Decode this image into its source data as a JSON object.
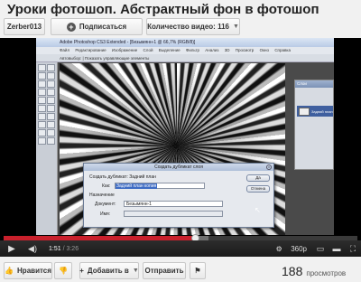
{
  "video_title": "Уроки фотошоп. Абстрактный фон в фотошоп",
  "channel": {
    "name": "Zerber013",
    "subscribe_label": "Подписаться",
    "video_count_label": "Количество видео: 116"
  },
  "photoshop": {
    "window_title": "Adobe Photoshop CS3 Extended - [Безымянн-1 @ 66,7% (RGB/8)]",
    "menu": [
      "Файл",
      "Редактирование",
      "Изображение",
      "Слой",
      "Выделение",
      "Фильтр",
      "Анализ",
      "3D",
      "Просмотр",
      "Окно",
      "Справка"
    ],
    "options_bar": "Автовыбор: | Показать управляющие элементы",
    "layers_panel": {
      "header": "Слои",
      "layer_name": "Задний план"
    },
    "dialog": {
      "title": "Создать дубликат слоя",
      "duplicate_label": "Создать дубликат:",
      "duplicate_value": "Задний план",
      "as_label": "Как:",
      "as_value": "Задний план копия",
      "destination_label": "Назначение",
      "document_label": "Документ:",
      "document_value": "Безымянн-1",
      "name_label": "Имя:",
      "ok_label": "Да",
      "cancel_label": "Отмена"
    }
  },
  "player": {
    "current_time": "1:51",
    "duration": "/ 3:26",
    "progress": 0.54,
    "buffered": 0.58,
    "quality": "360p"
  },
  "actions": {
    "like_label": "Нравится",
    "add_to_label": "Добавить в",
    "share_label": "Отправить"
  },
  "views": {
    "count": "188",
    "label": "просмотров"
  },
  "icons": {
    "like": "thumbs-up-icon",
    "dislike": "thumbs-down-icon",
    "play": "play-icon",
    "volume": "volume-icon",
    "flag": "flag-icon"
  }
}
